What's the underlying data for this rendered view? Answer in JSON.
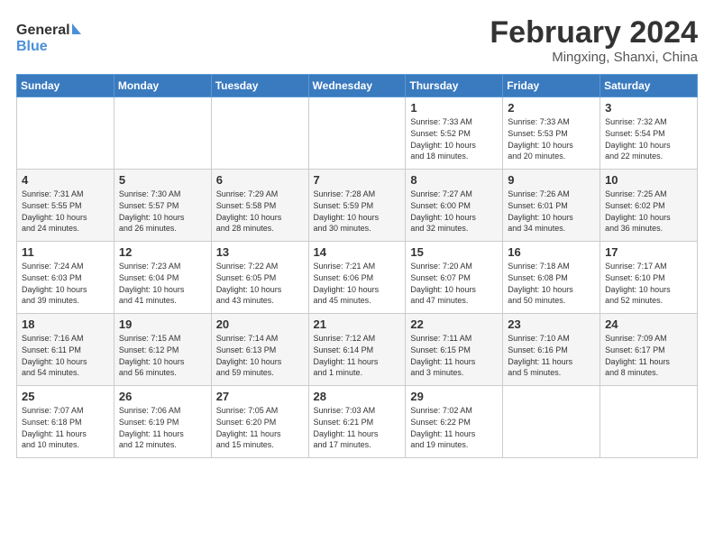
{
  "logo": {
    "line1": "General",
    "line2": "Blue"
  },
  "header": {
    "title": "February 2024",
    "location": "Mingxing, Shanxi, China"
  },
  "weekdays": [
    "Sunday",
    "Monday",
    "Tuesday",
    "Wednesday",
    "Thursday",
    "Friday",
    "Saturday"
  ],
  "weeks": [
    [
      {
        "day": "",
        "info": ""
      },
      {
        "day": "",
        "info": ""
      },
      {
        "day": "",
        "info": ""
      },
      {
        "day": "",
        "info": ""
      },
      {
        "day": "1",
        "info": "Sunrise: 7:33 AM\nSunset: 5:52 PM\nDaylight: 10 hours\nand 18 minutes."
      },
      {
        "day": "2",
        "info": "Sunrise: 7:33 AM\nSunset: 5:53 PM\nDaylight: 10 hours\nand 20 minutes."
      },
      {
        "day": "3",
        "info": "Sunrise: 7:32 AM\nSunset: 5:54 PM\nDaylight: 10 hours\nand 22 minutes."
      }
    ],
    [
      {
        "day": "4",
        "info": "Sunrise: 7:31 AM\nSunset: 5:55 PM\nDaylight: 10 hours\nand 24 minutes."
      },
      {
        "day": "5",
        "info": "Sunrise: 7:30 AM\nSunset: 5:57 PM\nDaylight: 10 hours\nand 26 minutes."
      },
      {
        "day": "6",
        "info": "Sunrise: 7:29 AM\nSunset: 5:58 PM\nDaylight: 10 hours\nand 28 minutes."
      },
      {
        "day": "7",
        "info": "Sunrise: 7:28 AM\nSunset: 5:59 PM\nDaylight: 10 hours\nand 30 minutes."
      },
      {
        "day": "8",
        "info": "Sunrise: 7:27 AM\nSunset: 6:00 PM\nDaylight: 10 hours\nand 32 minutes."
      },
      {
        "day": "9",
        "info": "Sunrise: 7:26 AM\nSunset: 6:01 PM\nDaylight: 10 hours\nand 34 minutes."
      },
      {
        "day": "10",
        "info": "Sunrise: 7:25 AM\nSunset: 6:02 PM\nDaylight: 10 hours\nand 36 minutes."
      }
    ],
    [
      {
        "day": "11",
        "info": "Sunrise: 7:24 AM\nSunset: 6:03 PM\nDaylight: 10 hours\nand 39 minutes."
      },
      {
        "day": "12",
        "info": "Sunrise: 7:23 AM\nSunset: 6:04 PM\nDaylight: 10 hours\nand 41 minutes."
      },
      {
        "day": "13",
        "info": "Sunrise: 7:22 AM\nSunset: 6:05 PM\nDaylight: 10 hours\nand 43 minutes."
      },
      {
        "day": "14",
        "info": "Sunrise: 7:21 AM\nSunset: 6:06 PM\nDaylight: 10 hours\nand 45 minutes."
      },
      {
        "day": "15",
        "info": "Sunrise: 7:20 AM\nSunset: 6:07 PM\nDaylight: 10 hours\nand 47 minutes."
      },
      {
        "day": "16",
        "info": "Sunrise: 7:18 AM\nSunset: 6:08 PM\nDaylight: 10 hours\nand 50 minutes."
      },
      {
        "day": "17",
        "info": "Sunrise: 7:17 AM\nSunset: 6:10 PM\nDaylight: 10 hours\nand 52 minutes."
      }
    ],
    [
      {
        "day": "18",
        "info": "Sunrise: 7:16 AM\nSunset: 6:11 PM\nDaylight: 10 hours\nand 54 minutes."
      },
      {
        "day": "19",
        "info": "Sunrise: 7:15 AM\nSunset: 6:12 PM\nDaylight: 10 hours\nand 56 minutes."
      },
      {
        "day": "20",
        "info": "Sunrise: 7:14 AM\nSunset: 6:13 PM\nDaylight: 10 hours\nand 59 minutes."
      },
      {
        "day": "21",
        "info": "Sunrise: 7:12 AM\nSunset: 6:14 PM\nDaylight: 11 hours\nand 1 minute."
      },
      {
        "day": "22",
        "info": "Sunrise: 7:11 AM\nSunset: 6:15 PM\nDaylight: 11 hours\nand 3 minutes."
      },
      {
        "day": "23",
        "info": "Sunrise: 7:10 AM\nSunset: 6:16 PM\nDaylight: 11 hours\nand 5 minutes."
      },
      {
        "day": "24",
        "info": "Sunrise: 7:09 AM\nSunset: 6:17 PM\nDaylight: 11 hours\nand 8 minutes."
      }
    ],
    [
      {
        "day": "25",
        "info": "Sunrise: 7:07 AM\nSunset: 6:18 PM\nDaylight: 11 hours\nand 10 minutes."
      },
      {
        "day": "26",
        "info": "Sunrise: 7:06 AM\nSunset: 6:19 PM\nDaylight: 11 hours\nand 12 minutes."
      },
      {
        "day": "27",
        "info": "Sunrise: 7:05 AM\nSunset: 6:20 PM\nDaylight: 11 hours\nand 15 minutes."
      },
      {
        "day": "28",
        "info": "Sunrise: 7:03 AM\nSunset: 6:21 PM\nDaylight: 11 hours\nand 17 minutes."
      },
      {
        "day": "29",
        "info": "Sunrise: 7:02 AM\nSunset: 6:22 PM\nDaylight: 11 hours\nand 19 minutes."
      },
      {
        "day": "",
        "info": ""
      },
      {
        "day": "",
        "info": ""
      }
    ]
  ]
}
